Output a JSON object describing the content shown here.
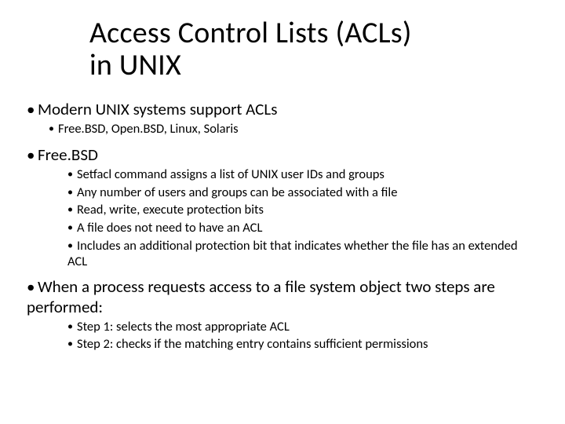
{
  "slide": {
    "title_line1": "Access Control Lists (ACLs)",
    "title_line2": "in UNIX",
    "items": {
      "i0": {
        "text": "Modern UNIX systems support ACLs"
      },
      "i0_sub": {
        "s0": "Free.BSD, Open.BSD, Linux, Solaris"
      },
      "i1": {
        "text": "Free.BSD"
      },
      "i1_sub": {
        "s0": "Setfacl command assigns a list of UNIX user IDs and groups",
        "s1": "Any number of users and groups can be associated with a file",
        "s2": "Read, write, execute protection bits",
        "s3": "A file does not need to have an ACL",
        "s4": "Includes an additional protection bit that indicates whether the file has an extended ACL"
      },
      "i2": {
        "text": "When a process requests access to a file system object two steps are performed:"
      },
      "i2_sub": {
        "s0": "Step 1: selects the most appropriate ACL",
        "s1": "Step 2: checks if the matching entry contains sufficient permissions"
      }
    }
  }
}
